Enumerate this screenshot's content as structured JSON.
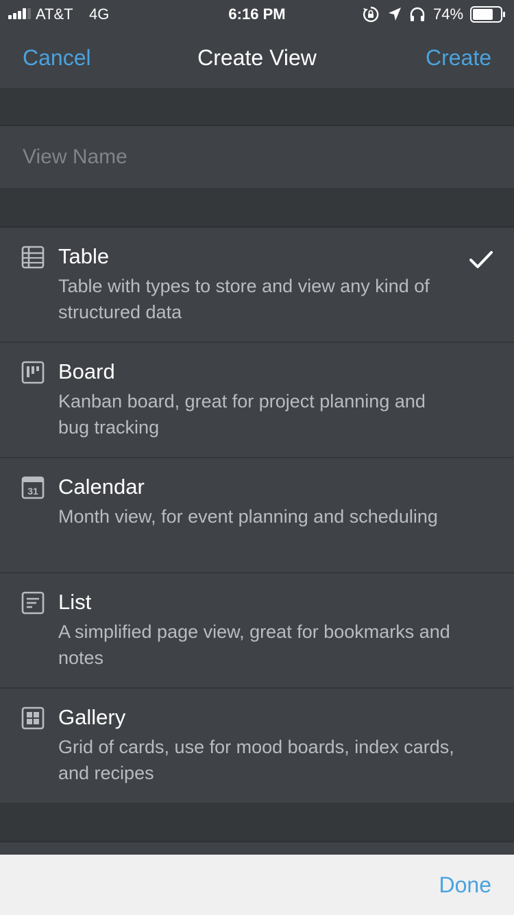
{
  "status_bar": {
    "carrier": "AT&T",
    "network": "4G",
    "time": "6:16 PM",
    "battery_percent": "74%",
    "battery_level": 0.74,
    "icons": [
      "signal-icon",
      "rotation-lock-icon",
      "location-icon",
      "headphones-icon",
      "battery-icon"
    ]
  },
  "nav": {
    "cancel_label": "Cancel",
    "title": "Create View",
    "create_label": "Create"
  },
  "view_name": {
    "value": "",
    "placeholder": "View Name"
  },
  "options": [
    {
      "icon": "table-icon",
      "label": "Table",
      "description": "Table with types to store and view any kind of structured data",
      "selected": true
    },
    {
      "icon": "board-icon",
      "label": "Board",
      "description": "Kanban board, great for project planning and bug tracking",
      "selected": false
    },
    {
      "icon": "calendar-icon",
      "label": "Calendar",
      "description": "Month view, for event planning and scheduling",
      "selected": false
    },
    {
      "icon": "list-icon",
      "label": "List",
      "description": "A simplified page view, great for bookmarks and notes",
      "selected": false
    },
    {
      "icon": "gallery-icon",
      "label": "Gallery",
      "description": "Grid of cards, use for mood boards, index cards, and recipes",
      "selected": false
    }
  ],
  "calendar_icon_day": "31",
  "bottom_bar": {
    "done_label": "Done"
  },
  "colors": {
    "accent": "#4aa3df",
    "background": "#3f4246",
    "spacer": "#35383b",
    "description_text": "#b9bdc1",
    "bottom_bar": "#f0f0f0"
  }
}
